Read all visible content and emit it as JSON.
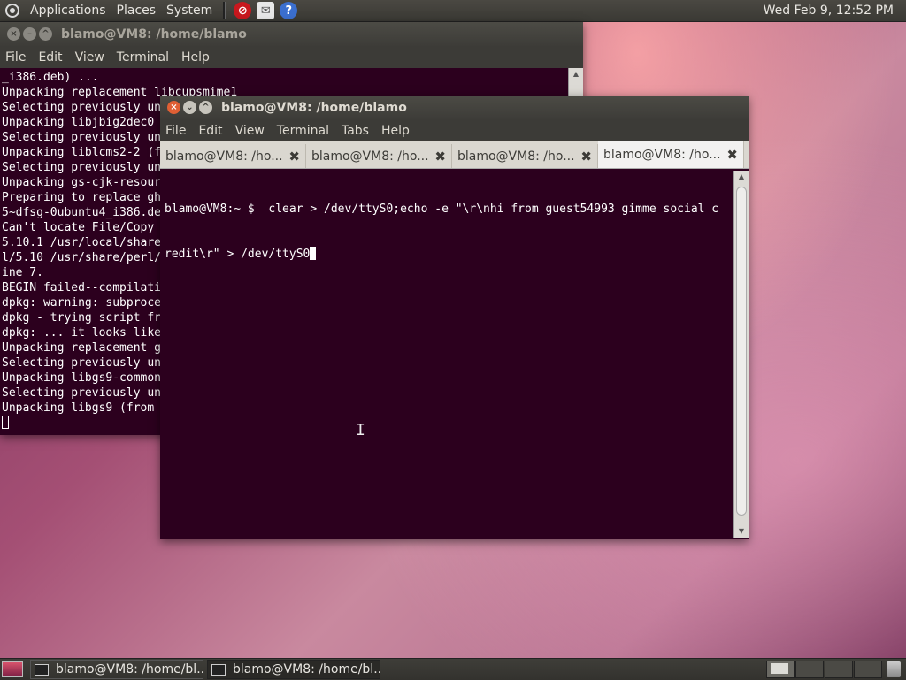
{
  "top_panel": {
    "menus": [
      "Applications",
      "Places",
      "System"
    ],
    "clock": "Wed Feb  9, 12:52 PM",
    "launchers": [
      "no-entry-icon",
      "mail-icon",
      "help-icon"
    ]
  },
  "back_window": {
    "title": "blamo@VM8: /home/blamo",
    "menu": [
      "File",
      "Edit",
      "View",
      "Terminal",
      "Help"
    ],
    "lines": [
      "_i386.deb) ...",
      "Unpacking replacement libcupsmime1",
      "Selecting previously un",
      "Unpacking libjbig2dec0",
      "Selecting previously un",
      "Unpacking liblcms2-2 (f",
      "Selecting previously un",
      "Unpacking gs-cjk-resour",
      "Preparing to replace gh",
      "5~dfsg-0ubuntu4_i386.de",
      "Can't locate File/Copy",
      "5.10.1 /usr/local/share",
      "l/5.10 /usr/share/perl/",
      "ine 7.",
      "BEGIN failed--compilati",
      "dpkg: warning: subproce",
      "dpkg - trying script fr",
      "dpkg: ... it looks like",
      "Unpacking replacement g",
      "Selecting previously un",
      "Unpacking libgs9-common",
      "Selecting previously un",
      "Unpacking libgs9 (from"
    ]
  },
  "front_window": {
    "title": "blamo@VM8: /home/blamo",
    "menu": [
      "File",
      "Edit",
      "View",
      "Terminal",
      "Tabs",
      "Help"
    ],
    "tabs": [
      {
        "label": "blamo@VM8: /ho..."
      },
      {
        "label": "blamo@VM8: /ho..."
      },
      {
        "label": "blamo@VM8: /ho..."
      },
      {
        "label": "blamo@VM8: /ho..."
      }
    ],
    "line1": "blamo@VM8:~ $  clear > /dev/ttyS0;echo -e \"\\r\\nhi from guest54993 gimme social c",
    "line2": "redit\\r\" > /dev/ttyS0"
  },
  "taskbar": {
    "tasks": [
      {
        "label": "blamo@VM8: /home/bl..."
      },
      {
        "label": "blamo@VM8: /home/bl..."
      }
    ]
  }
}
